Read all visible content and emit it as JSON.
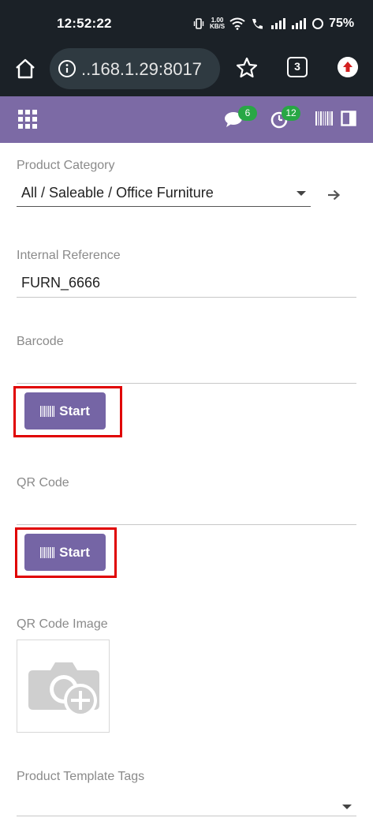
{
  "status_bar": {
    "time": "12:52:22",
    "net_speed_top": "1.00",
    "net_speed_bottom": "KB/S",
    "battery": "75%"
  },
  "browser": {
    "url": "..168.1.29:8017",
    "tab_count": "3"
  },
  "app_nav": {
    "messages_badge": "6",
    "activities_badge": "12"
  },
  "form": {
    "product_category": {
      "label": "Product Category",
      "value": "All / Saleable / Office Furniture"
    },
    "internal_reference": {
      "label": "Internal Reference",
      "value": "FURN_6666"
    },
    "barcode": {
      "label": "Barcode",
      "value": "",
      "start_label": "Start"
    },
    "qr_code": {
      "label": "QR Code",
      "value": "",
      "start_label": "Start"
    },
    "qr_code_image": {
      "label": "QR Code Image"
    },
    "product_template_tags": {
      "label": "Product Template Tags",
      "value": ""
    }
  },
  "colors": {
    "nav_purple": "#7c6aa5",
    "button_purple": "#7565a5",
    "highlight_red": "#e00000",
    "badge_green": "#28a745",
    "chrome_dark": "#1b2127"
  }
}
